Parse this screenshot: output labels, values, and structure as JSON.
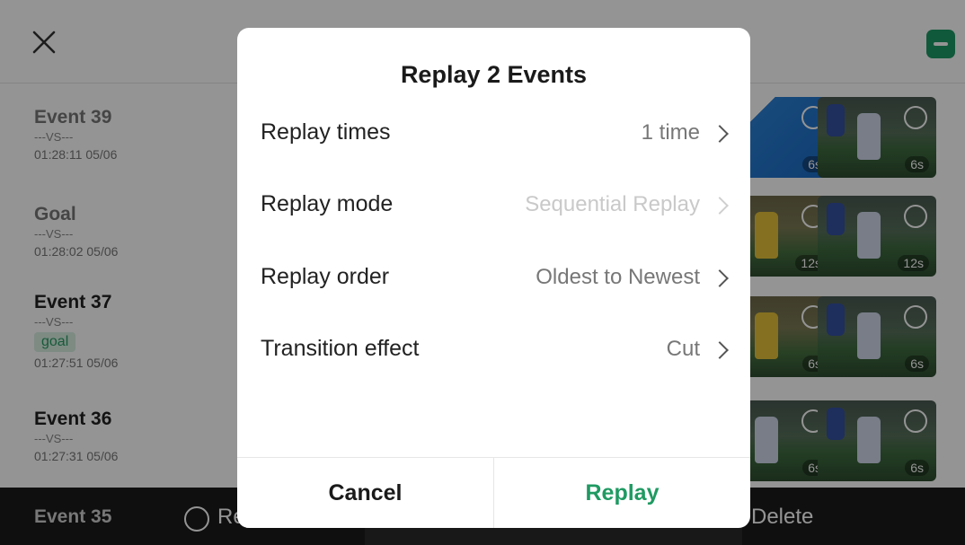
{
  "events": [
    {
      "title": "Event 39",
      "vs": "---VS---",
      "time": "01:28:11 05/06",
      "tag": ""
    },
    {
      "title": "Goal",
      "vs": "---VS---",
      "time": "01:28:02 05/06",
      "tag": ""
    },
    {
      "title": "Event 37",
      "vs": "---VS---",
      "time": "01:27:51 05/06",
      "tag": "goal"
    },
    {
      "title": "Event 36",
      "vs": "---VS---",
      "time": "01:27:31 05/06",
      "tag": ""
    }
  ],
  "thumbnails": [
    "6s",
    "6s",
    "12s",
    "12s",
    "6s",
    "6s",
    "6s",
    "6s"
  ],
  "bottom_bar": {
    "event_label": "Event 35",
    "replay_label": "Replay",
    "delete_label": "Delete"
  },
  "dialog": {
    "title": "Replay 2 Events",
    "options": [
      {
        "label": "Replay times",
        "value": "1 time",
        "disabled": false
      },
      {
        "label": "Replay mode",
        "value": "Sequential Replay",
        "disabled": true
      },
      {
        "label": "Replay order",
        "value": "Oldest to Newest",
        "disabled": false
      },
      {
        "label": "Transition effect",
        "value": "Cut",
        "disabled": false
      }
    ],
    "cancel_label": "Cancel",
    "confirm_label": "Replay"
  },
  "colors": {
    "accent": "#1f9a62",
    "overlay": "rgba(0,0,0,0.42)",
    "dialog_bg": "#ffffff"
  },
  "icons": [
    "close-icon",
    "select-all-icon",
    "replay-icon",
    "chevron-right-icon",
    "select-circle-icon"
  ]
}
